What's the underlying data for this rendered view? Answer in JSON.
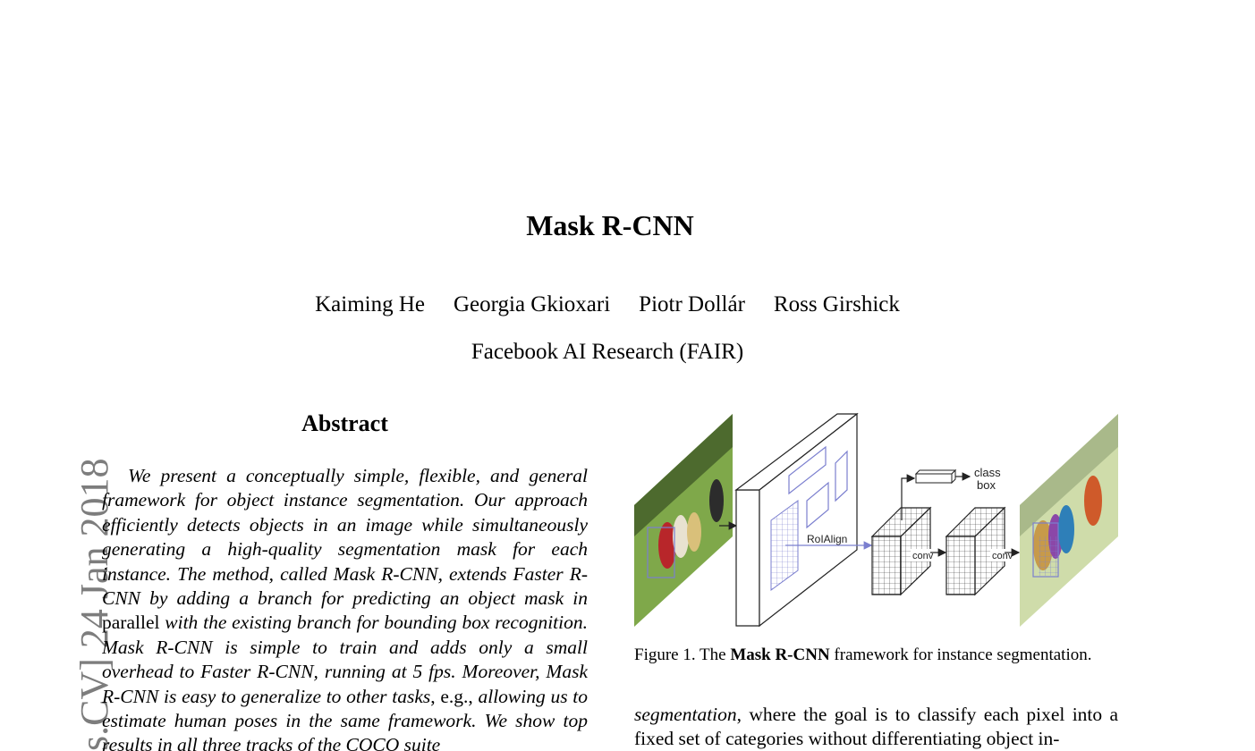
{
  "paper": {
    "title": "Mask R-CNN",
    "authors": [
      "Kaiming He",
      "Georgia Gkioxari",
      "Piotr Dollár",
      "Ross Girshick"
    ],
    "affiliation": "Facebook AI Research (FAIR)",
    "arxiv_stamp": "s.CV]  24 Jan 2018"
  },
  "abstract": {
    "heading": "Abstract",
    "part1": "We present a conceptually simple, flexible, and general framework for object instance segmentation. Our approach efficiently detects objects in an image while simultaneously generating a high-quality segmentation mask for each instance. The method, called Mask R-CNN, extends Faster R-CNN by adding a branch for predicting an object mask in ",
    "part2_upright": "parallel",
    "part3": " with the existing branch for bounding box recognition. Mask R-CNN is simple to train and adds only a small overhead to Faster R-CNN, running at 5 fps. Moreover, Mask R-CNN is easy to generalize to other tasks",
    "part4_upright": ", e.g.,",
    "part5": " allowing us to estimate human poses in the same framework. We show top results in all three tracks of the COCO suite"
  },
  "figure": {
    "label_roialign": "RoIAlign",
    "label_conv1": "conv",
    "label_conv2": "conv",
    "label_class": "class",
    "label_box": "box",
    "caption_prefix": "Figure 1. The ",
    "caption_bold": "Mask R-CNN",
    "caption_suffix": " framework for instance segmentation."
  },
  "column2": {
    "term": "segmentation",
    "text": ", where the goal is to classify each pixel into a fixed set of categories without differentiating object in-"
  },
  "colors": {
    "roi_blue": "#7b7fcf",
    "stamp_gray": "#7d7d7d"
  }
}
